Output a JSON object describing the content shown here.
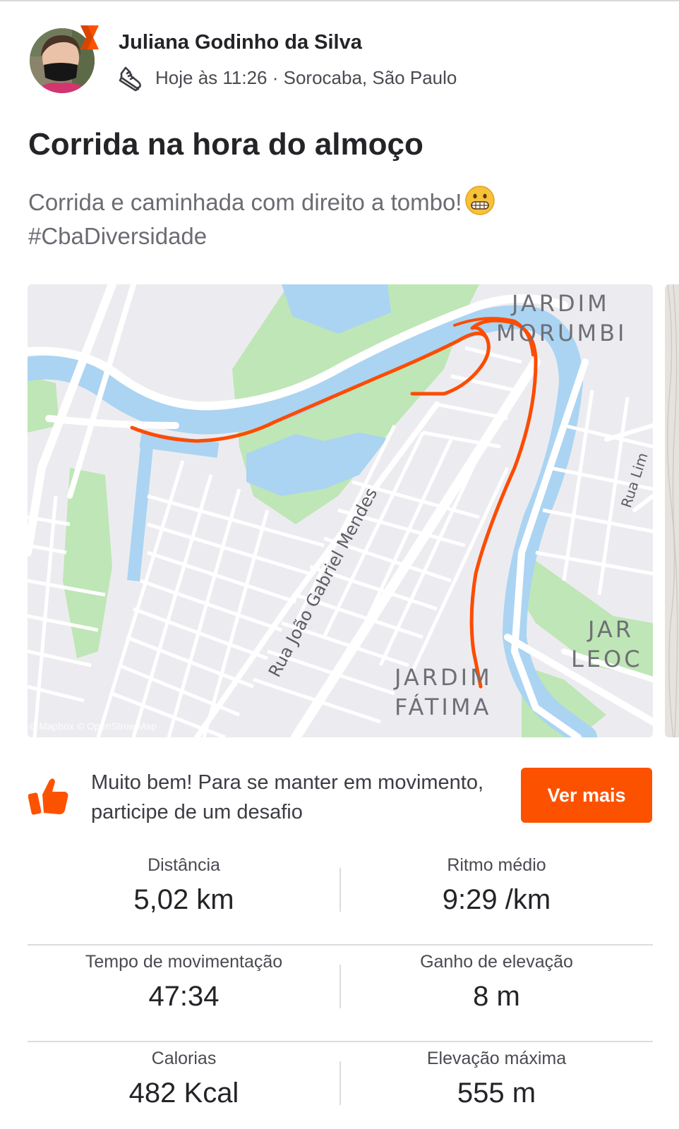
{
  "header": {
    "athlete_name": "Juliana Godinho da Silva",
    "activity_icon": "shoe-icon",
    "meta": "Hoje às 11:26 · Sorocaba, São Paulo"
  },
  "activity": {
    "title": "Corrida na hora do almoço",
    "description_line1": "Corrida e caminhada com direito a tombo!",
    "description_emoji": "grimacing-face",
    "description_line2": "#CbaDiversidade"
  },
  "map": {
    "labels": {
      "jardim_morumbi_1": "JARDIM",
      "jardim_morumbi_2": "MORUMBI",
      "jardim_fatima_1": "JARDIM",
      "jardim_fatima_2": "FÁTIMA",
      "jar_leo_1": "JAR",
      "jar_leo_2": "LEOC",
      "street_main": "Rua João Gabriel Mendes",
      "street_right": "Rua Lim"
    },
    "attribution": "© Mapbox © OpenStreetMap",
    "route_color": "#fc4c02"
  },
  "promo": {
    "icon": "thumbs-up-icon",
    "text": "Muito bem! Para se manter em movimento, participe de um desafio",
    "button_label": "Ver mais",
    "accent_color": "#fc5200"
  },
  "stats": [
    {
      "label": "Distância",
      "value": "5,02 km"
    },
    {
      "label": "Ritmo médio",
      "value": "9:29 /km"
    },
    {
      "label": "Tempo de movimentação",
      "value": "47:34"
    },
    {
      "label": "Ganho de elevação",
      "value": "8 m"
    },
    {
      "label": "Calorias",
      "value": "482 Kcal"
    },
    {
      "label": "Elevação máxima",
      "value": "555 m"
    }
  ]
}
